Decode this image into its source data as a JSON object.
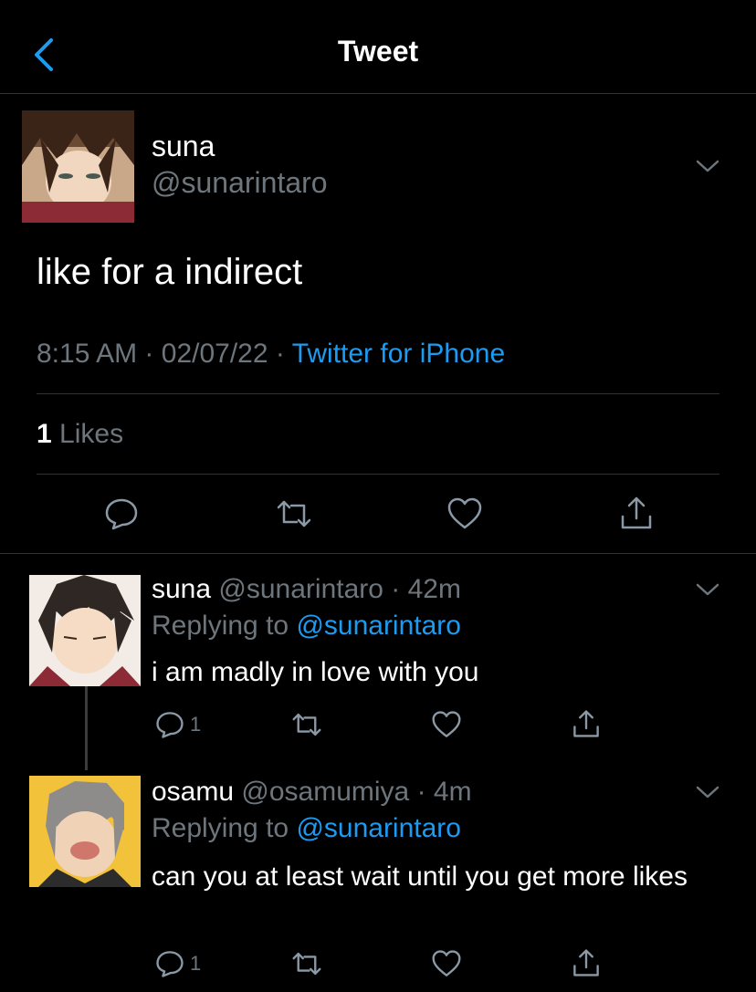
{
  "header": {
    "title": "Tweet"
  },
  "main_tweet": {
    "display_name": "suna",
    "handle": "@sunarintaro",
    "text": "like for a indirect",
    "time": "8:15 AM",
    "date": "02/07/22",
    "separator": "·",
    "source": "Twitter for iPhone",
    "likes_count": "1",
    "likes_label": "Likes"
  },
  "replies": [
    {
      "display_name": "suna",
      "handle": "@sunarintaro",
      "age": "· 42m",
      "replying_prefix": "Replying to",
      "replying_handle": "@sunarintaro",
      "text": "i am madly in love with you",
      "reply_count": "1"
    },
    {
      "display_name": "osamu",
      "handle": "@osamumiya",
      "age": "· 4m",
      "replying_prefix": "Replying to",
      "replying_handle": "@sunarintaro",
      "text": "can you at least wait until you get more likes",
      "reply_count": "1"
    }
  ],
  "colors": {
    "accent": "#1d9bf0",
    "muted": "#6e767d",
    "divider": "#2f3336"
  },
  "icons": [
    "back-chevron-icon",
    "chevron-down-icon",
    "reply-icon",
    "retweet-icon",
    "like-icon",
    "share-icon"
  ]
}
